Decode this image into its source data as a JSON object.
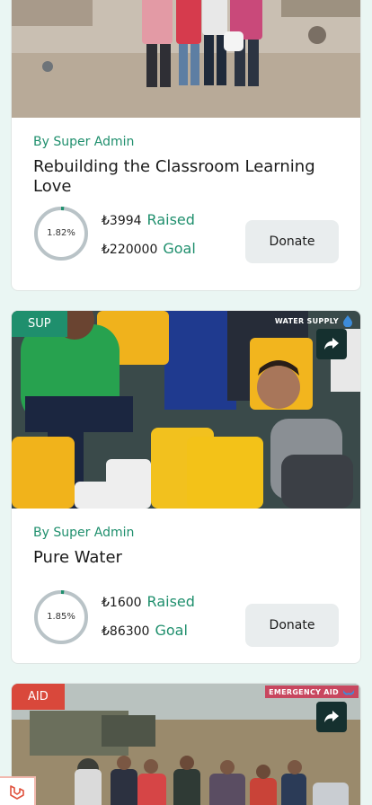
{
  "cards": [
    {
      "author": "By Super Admin",
      "title": "Rebuilding the Classroom Learning Love",
      "percent_label": "1.82%",
      "percent": 1.82,
      "raised_amount": "₺3994",
      "raised_label": "Raised",
      "goal_amount": "₺220000",
      "goal_label": "Goal",
      "donate_label": "Donate"
    },
    {
      "tag": "SUP",
      "tag_color": "#1f8f6d",
      "corner_label": "WATER SUPPLY",
      "author": "By Super Admin",
      "title": "Pure Water",
      "percent_label": "1.85%",
      "percent": 1.85,
      "raised_amount": "₺1600",
      "raised_label": "Raised",
      "goal_amount": "₺86300",
      "goal_label": "Goal",
      "donate_label": "Donate"
    },
    {
      "tag": "AID",
      "tag_color": "#d9483b",
      "corner_label": "EMERGENCY AID"
    }
  ],
  "icons": {
    "share": "share-icon",
    "water_drop": "water-drop-icon",
    "hands": "hands-icon",
    "logo": "laravel-logo-icon"
  },
  "colors": {
    "accent": "#1f8f6d",
    "ring_track": "#b9c3c7",
    "ring_fill": "#1f8f6d"
  }
}
